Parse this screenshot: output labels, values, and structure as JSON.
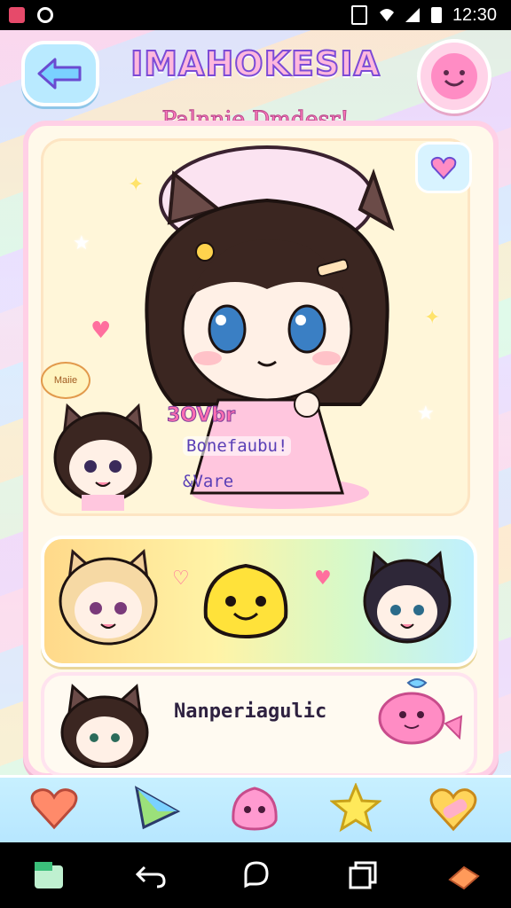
{
  "status_bar": {
    "time": "12:30",
    "icons": [
      "app-icon",
      "sync-icon",
      "wifi-icon",
      "signal-icon",
      "battery-icon"
    ]
  },
  "header": {
    "title": "IMAHOKESIA",
    "subtitle": "Palnnie Dmdesr!",
    "back_icon": "arrow-left-icon",
    "profile_icon": "smiley-face-icon"
  },
  "hero": {
    "bubble_text": "Maiie",
    "stat_line_1": "3OVbr",
    "stat_line_2": "Bonefaubu!",
    "stat_line_3": "&Vare"
  },
  "bottom_card": {
    "label": "Nanperiagulic"
  },
  "toolbar": {
    "items": [
      "heart-icon",
      "triangle-icon",
      "slime-icon",
      "star-icon",
      "bandage-heart-icon"
    ]
  },
  "colors": {
    "accent_pink": "#ff7bbd",
    "accent_purple": "#7c4bd6",
    "panel_bg": "#fff9ea",
    "toolbar_bg": "#b6e6ff"
  }
}
